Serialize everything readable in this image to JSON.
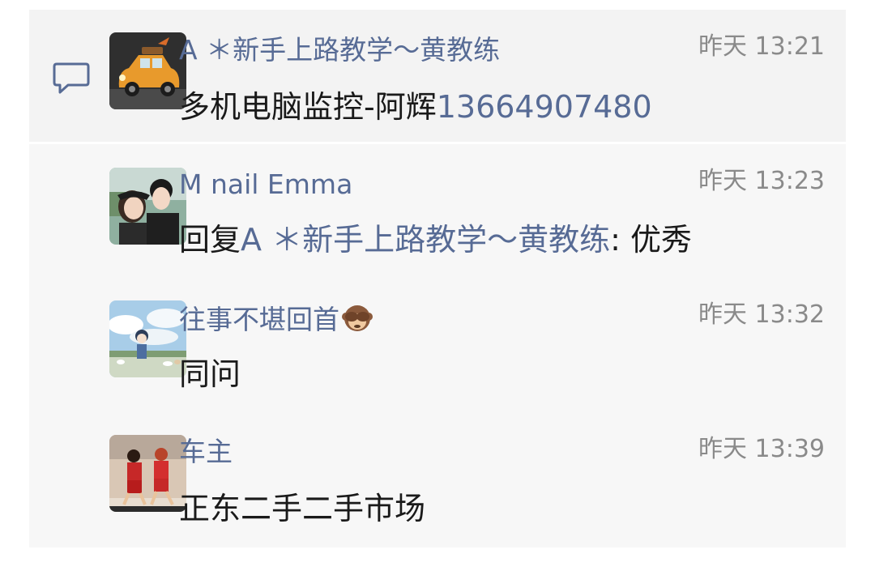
{
  "comments": [
    {
      "name": "A ＊新手上路教学～黄教练",
      "time": "昨天 13:21",
      "message_text": "多机电脑监控-阿辉",
      "message_phone": "13664907480",
      "avatar": "orange-cartoon-car-avatar"
    },
    {
      "name": "M nail Emma",
      "time": "昨天 13:23",
      "reply_prefix": "回复",
      "reply_to": "A ＊新手上路教学～黄教练",
      "reply_text": ": 优秀",
      "avatar": "couple-photo-avatar"
    },
    {
      "name": "往事不堪回首",
      "name_emoji": "see-no-evil-monkey-emoji",
      "time": "昨天 13:32",
      "message_text": "同问",
      "avatar": "anime-landscape-avatar"
    },
    {
      "name": "车主",
      "time": "昨天 13:39",
      "message_text": "正东二手二手市场",
      "avatar": "basketball-anime-avatar"
    }
  ],
  "colors": {
    "name_link": "#576b95",
    "time_gray": "#8a8a8a",
    "panel_bg": "#f7f7f7",
    "text": "#1a1a1a"
  }
}
